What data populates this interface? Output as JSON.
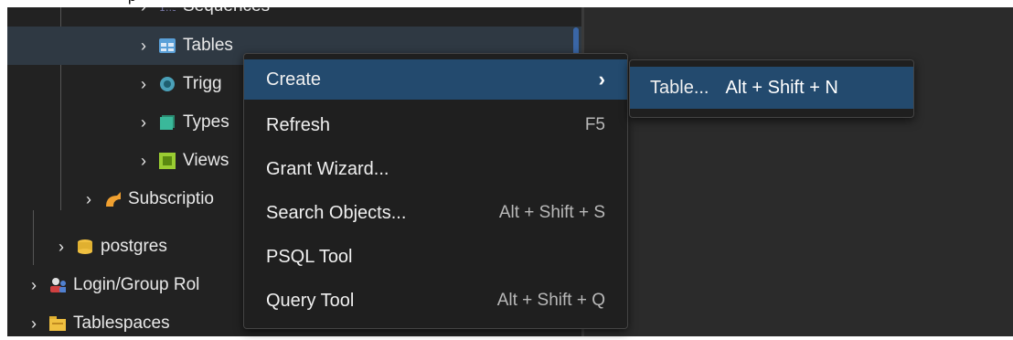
{
  "top_fragment": "p",
  "tree": {
    "rows": [
      {
        "label": "Sequences",
        "icon": "sequences-icon",
        "color": "#7a7aa8"
      },
      {
        "label": "Tables",
        "icon": "table-icon",
        "color": "#5aa0d8"
      },
      {
        "label": "Trigg",
        "icon": "trigger-function-icon",
        "color": "#4aa0b8"
      },
      {
        "label": "Types",
        "icon": "types-icon",
        "color": "#3ab89a"
      },
      {
        "label": "Views",
        "icon": "views-icon",
        "color": "#9acd32"
      },
      {
        "label": "Subscriptio",
        "icon": "subscriptions-icon",
        "color": "#f0a030"
      },
      {
        "label": "postgres",
        "icon": "database-icon",
        "color": "#f0c040"
      },
      {
        "label": "Login/Group Rol",
        "icon": "login-roles-icon",
        "color": "#d04040"
      },
      {
        "label": "Tablespaces",
        "icon": "tablespaces-icon",
        "color": "#e0b030"
      }
    ]
  },
  "context_menu": {
    "items": [
      {
        "label": "Create",
        "shortcut": "›",
        "has_submenu": true
      },
      {
        "label": "Refresh",
        "shortcut": "F5"
      },
      {
        "label": "Grant Wizard...",
        "shortcut": ""
      },
      {
        "label": "Search Objects...",
        "shortcut": "Alt + Shift + S"
      },
      {
        "label": "PSQL Tool",
        "shortcut": ""
      },
      {
        "label": "Query Tool",
        "shortcut": "Alt + Shift + Q"
      }
    ]
  },
  "submenu": {
    "label": "Table...",
    "shortcut": "Alt + Shift + N"
  },
  "colors": {
    "panel_bg": "#222222",
    "menu_bg": "#1f1f1f",
    "menu_active": "#234a6e",
    "selected_row": "#2f3943"
  }
}
